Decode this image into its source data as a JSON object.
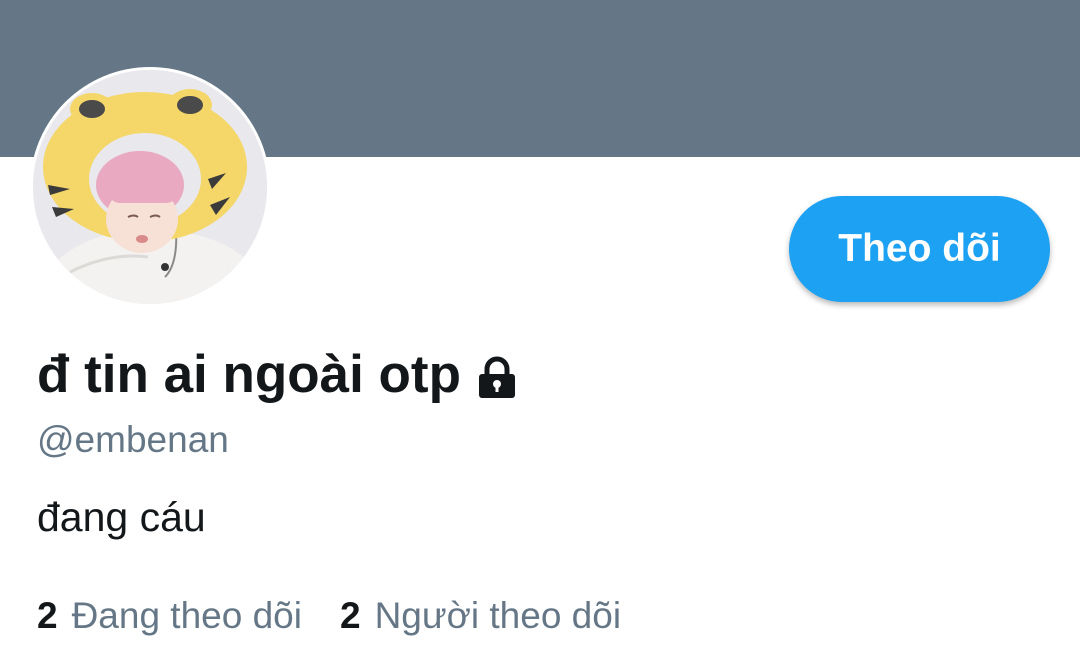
{
  "profile": {
    "display_name": "đ tin ai ngoài otp",
    "handle": "@embenan",
    "bio": "đang cáu",
    "lock_icon": "lock-icon",
    "avatar_icon": "profile-avatar"
  },
  "actions": {
    "follow_label": "Theo dõi"
  },
  "stats": {
    "following_count": "2",
    "following_label": "Đang theo dõi",
    "followers_count": "2",
    "followers_label": "Người theo dõi"
  },
  "colors": {
    "banner": "#657786",
    "accent": "#1da1f2",
    "primary_text": "#14171a",
    "secondary_text": "#657786"
  }
}
